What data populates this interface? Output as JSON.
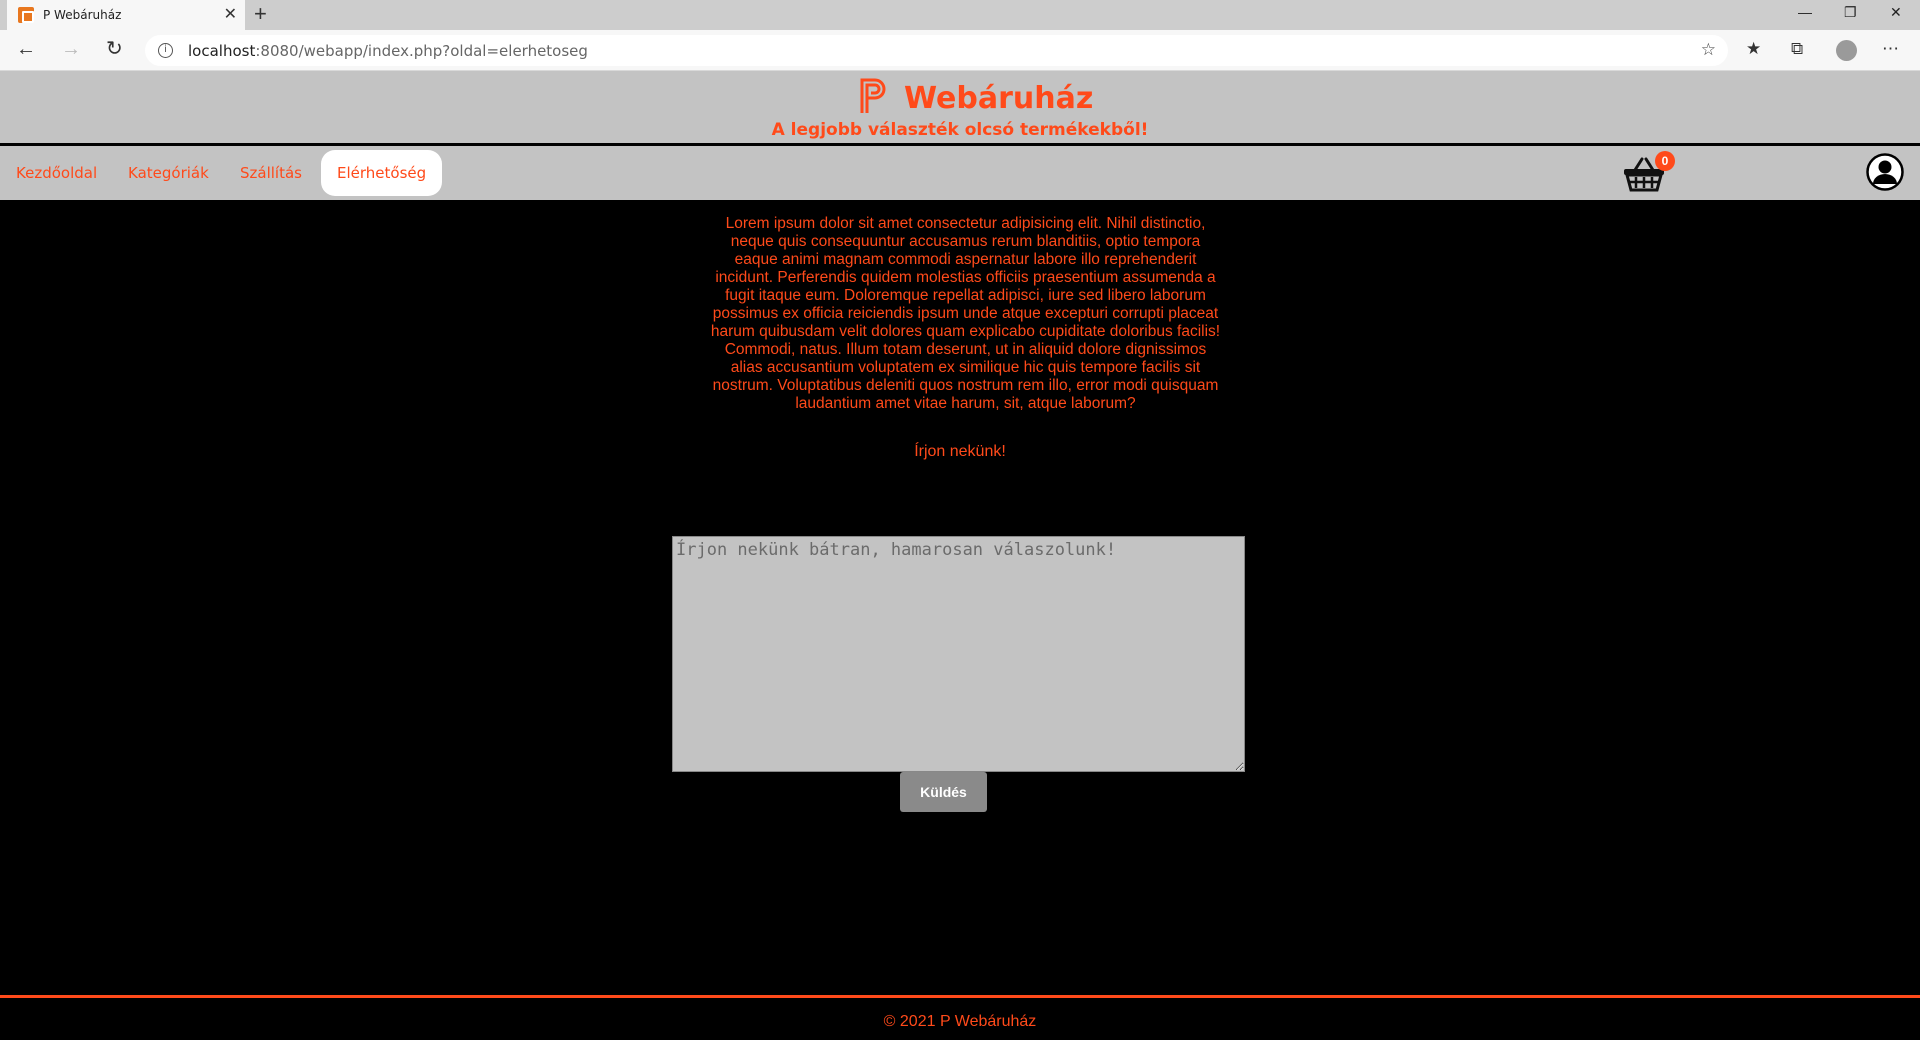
{
  "browser": {
    "tab_title": "P Webáruház",
    "tab_close": "✕",
    "new_tab": "+",
    "url_host": "localhost",
    "url_rest": ":8080/webapp/index.php?oldal=elerhetoseg",
    "info_glyph": "i"
  },
  "header": {
    "title": "Webáruház",
    "slogan": "A legjobb választék olcsó termékekből!"
  },
  "nav": {
    "items": [
      "Kezdőoldal",
      "Kategóriák",
      "Szállítás",
      "Elérhetőség"
    ],
    "active": "Elérhetőség"
  },
  "cart": {
    "count": "0"
  },
  "main": {
    "intro": "Lorem ipsum dolor sit amet consectetur adipisicing elit. Nihil distinctio, neque quis consequuntur accusamus rerum blanditiis, optio tempora eaque animi magnam commodi aspernatur labore illo reprehenderit incidunt. Perferendis quidem molestias officiis praesentium assumenda a fugit itaque eum. Doloremque repellat adipisci, iure sed libero laborum possimus ex officia reiciendis ipsum unde atque excepturi corrupti placeat harum quibusdam velit dolores quam explicabo cupiditate doloribus facilis! Commodi, natus. Illum totam deserunt, ut in aliquid dolore dignissimos alias accusantium voluptatem ex similique hic quis tempore facilis sit nostrum. Voluptatibus deleniti quos nostrum rem illo, error modi quisquam laudantium amet vitae harum, sit, atque laborum?",
    "write_us": "Írjon nekünk!",
    "message_placeholder": "Írjon nekünk bátran, hamarosan válaszolunk!",
    "send_label": "Küldés"
  },
  "footer": {
    "copyright": "© 2021 P Webáruház"
  },
  "colors": {
    "accent": "#ff4a1a",
    "header_bg": "#c3c3c3",
    "page_bg": "#000000"
  }
}
